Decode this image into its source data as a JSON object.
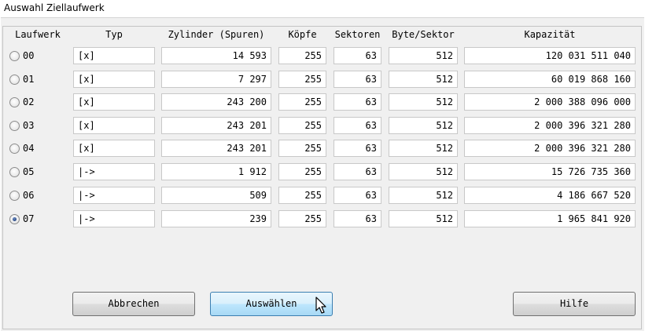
{
  "window": {
    "title": "Auswahl Ziellaufwerk"
  },
  "columns": {
    "drive": "Laufwerk",
    "type": "Typ",
    "cylinders": "Zylinder (Spuren)",
    "heads": "Köpfe",
    "sectors": "Sektoren",
    "bytes_per_sector": "Byte/Sektor",
    "capacity": "Kapazität"
  },
  "drives": [
    {
      "id": "00",
      "type": "[x]",
      "cylinders": "14 593",
      "heads": "255",
      "sectors": "63",
      "bytes_per_sector": "512",
      "capacity": "120 031 511 040",
      "selected": false
    },
    {
      "id": "01",
      "type": "[x]",
      "cylinders": "7 297",
      "heads": "255",
      "sectors": "63",
      "bytes_per_sector": "512",
      "capacity": "60 019 868 160",
      "selected": false
    },
    {
      "id": "02",
      "type": "[x]",
      "cylinders": "243 200",
      "heads": "255",
      "sectors": "63",
      "bytes_per_sector": "512",
      "capacity": "2 000 388 096 000",
      "selected": false
    },
    {
      "id": "03",
      "type": "[x]",
      "cylinders": "243 201",
      "heads": "255",
      "sectors": "63",
      "bytes_per_sector": "512",
      "capacity": "2 000 396 321 280",
      "selected": false
    },
    {
      "id": "04",
      "type": "[x]",
      "cylinders": "243 201",
      "heads": "255",
      "sectors": "63",
      "bytes_per_sector": "512",
      "capacity": "2 000 396 321 280",
      "selected": false
    },
    {
      "id": "05",
      "type": "|->",
      "cylinders": "1 912",
      "heads": "255",
      "sectors": "63",
      "bytes_per_sector": "512",
      "capacity": "15 726 735 360",
      "selected": false
    },
    {
      "id": "06",
      "type": "|->",
      "cylinders": "509",
      "heads": "255",
      "sectors": "63",
      "bytes_per_sector": "512",
      "capacity": "4 186 667 520",
      "selected": false
    },
    {
      "id": "07",
      "type": "|->",
      "cylinders": "239",
      "heads": "255",
      "sectors": "63",
      "bytes_per_sector": "512",
      "capacity": "1 965 841 920",
      "selected": true
    }
  ],
  "buttons": {
    "cancel": "Abbrechen",
    "select": "Auswählen",
    "help": "Hilfe"
  }
}
